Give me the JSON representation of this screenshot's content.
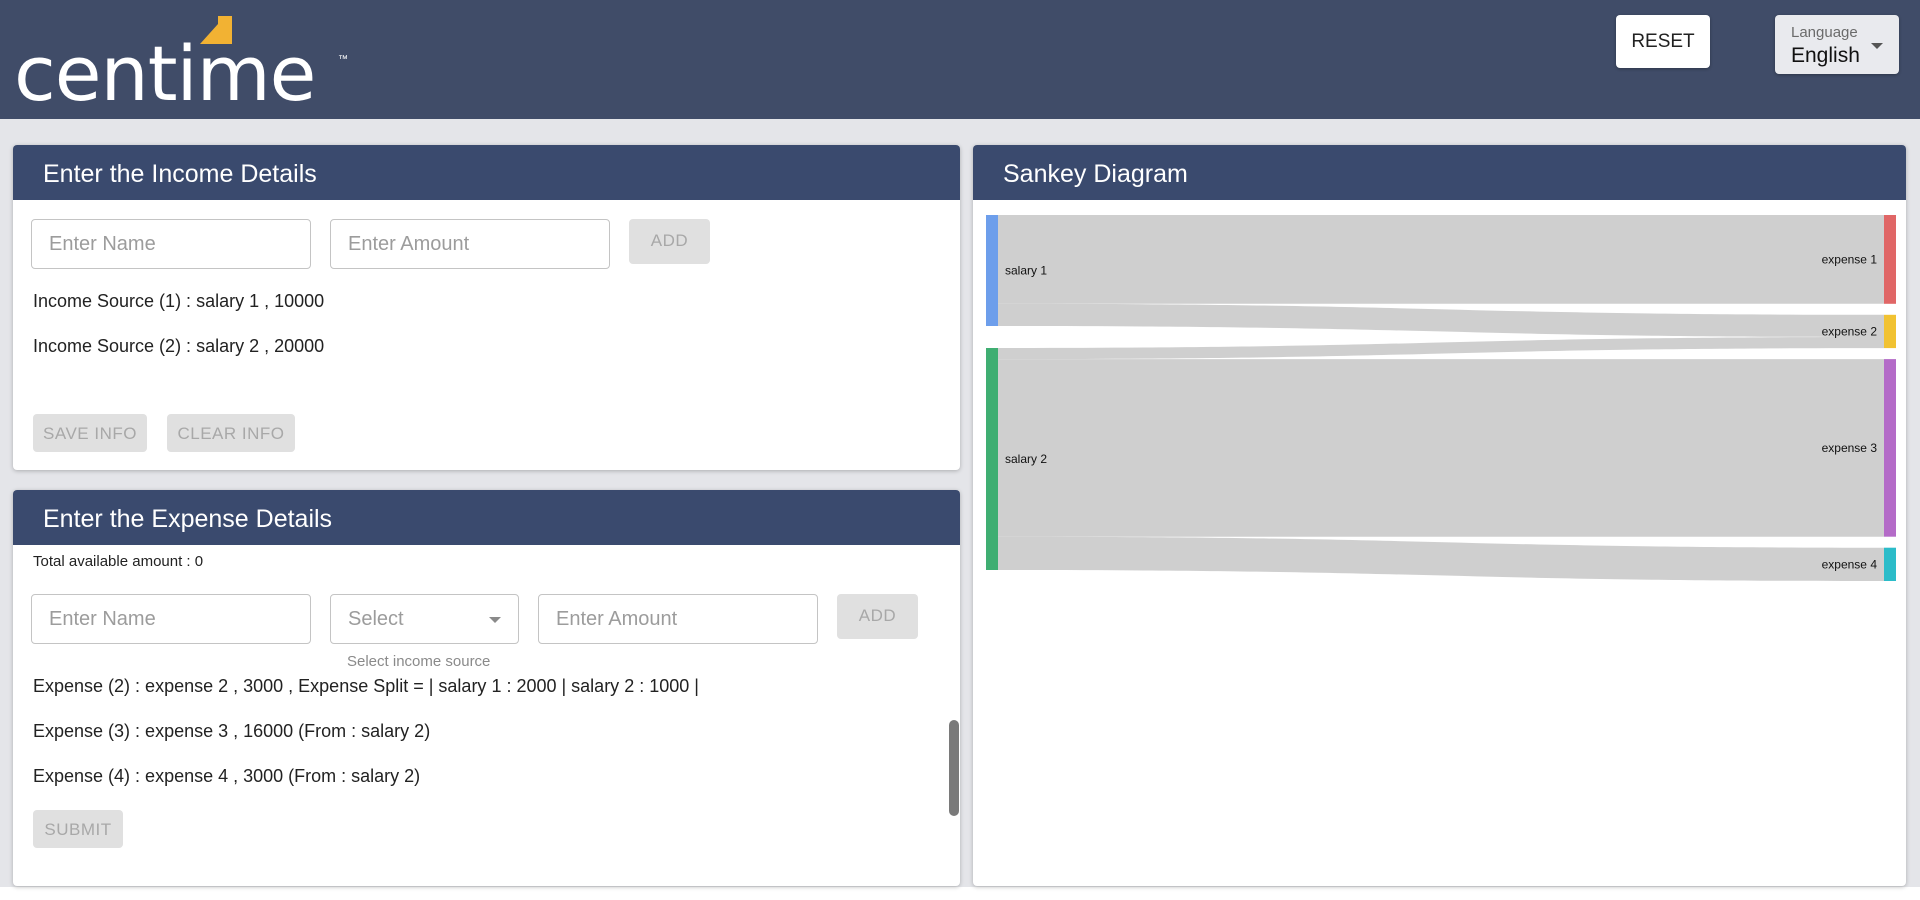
{
  "brand": {
    "name": "centime",
    "tm": "™",
    "accent": "#f2b233"
  },
  "header": {
    "reset_label": "RESET",
    "language_label": "Language",
    "language_value": "English"
  },
  "income": {
    "title": "Enter the Income Details",
    "name_placeholder": "Enter Name",
    "amount_placeholder": "Enter Amount",
    "add_label": "ADD",
    "sources": [
      "Income Source (1) : salary 1 , 10000",
      "Income Source (2) : salary 2 , 20000"
    ],
    "save_label": "SAVE INFO",
    "clear_label": "CLEAR INFO"
  },
  "expense": {
    "title": "Enter the Expense Details",
    "total_available": "Total available amount : 0",
    "name_placeholder": "Enter Name",
    "select_placeholder": "Select",
    "select_helper": "Select income source",
    "amount_placeholder": "Enter Amount",
    "add_label": "ADD",
    "items": [
      "Expense (2) : expense 2 , 3000 , Expense Split = | salary 1 : 2000 | salary 2 : 1000 |",
      "Expense (3) : expense 3 , 16000 (From : salary 2)",
      "Expense (4) : expense 4 , 3000 (From : salary 2)"
    ],
    "submit_label": "SUBMIT"
  },
  "sankey": {
    "title": "Sankey Diagram",
    "link_color": "#cccccc",
    "sources": [
      {
        "name": "salary 1",
        "value": 10000,
        "color": "#6d9eeb"
      },
      {
        "name": "salary 2",
        "value": 20000,
        "color": "#3fae72"
      }
    ],
    "targets": [
      {
        "name": "expense 1",
        "value": 8000,
        "color": "#e06666"
      },
      {
        "name": "expense 2",
        "value": 3000,
        "color": "#f1c232"
      },
      {
        "name": "expense 3",
        "value": 16000,
        "color": "#b46bc8"
      },
      {
        "name": "expense 4",
        "value": 3000,
        "color": "#2bbcc9"
      }
    ],
    "links": [
      {
        "source": "salary 1",
        "target": "expense 1",
        "value": 8000
      },
      {
        "source": "salary 1",
        "target": "expense 2",
        "value": 2000
      },
      {
        "source": "salary 2",
        "target": "expense 2",
        "value": 1000
      },
      {
        "source": "salary 2",
        "target": "expense 3",
        "value": 16000
      },
      {
        "source": "salary 2",
        "target": "expense 4",
        "value": 3000
      }
    ]
  }
}
